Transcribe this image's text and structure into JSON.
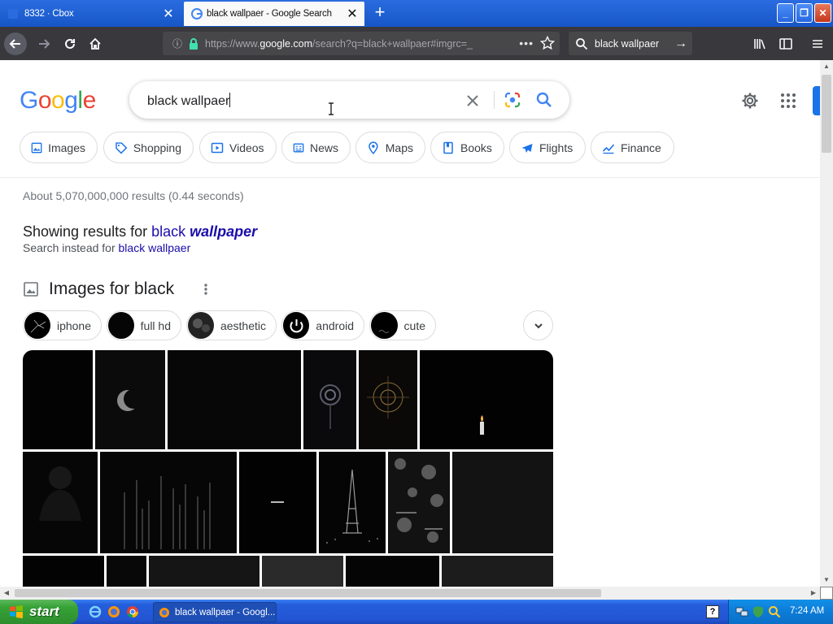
{
  "browser": {
    "tabs": [
      {
        "title": "8332 · Cbox",
        "active": false
      },
      {
        "title": "black wallpaer - Google Search",
        "active": true
      }
    ],
    "url": {
      "prefix": "https://www.",
      "domain": "google.com",
      "path": "/search?q=black+wallpaer#imgrc=_"
    },
    "search_bar_text": "black wallpaer"
  },
  "google": {
    "logo": [
      "G",
      "o",
      "o",
      "g",
      "l",
      "e"
    ],
    "logo_colors": [
      "#4285f4",
      "#ea4335",
      "#fbbc05",
      "#4285f4",
      "#34a853",
      "#ea4335"
    ],
    "query": "black wallpaer",
    "chips": [
      {
        "label": "Images",
        "icon": "image-icon"
      },
      {
        "label": "Shopping",
        "icon": "tag-icon"
      },
      {
        "label": "Videos",
        "icon": "play-icon"
      },
      {
        "label": "News",
        "icon": "newspaper-icon"
      },
      {
        "label": "Maps",
        "icon": "map-pin-icon"
      },
      {
        "label": "Books",
        "icon": "book-icon"
      },
      {
        "label": "Flights",
        "icon": "plane-icon"
      },
      {
        "label": "Finance",
        "icon": "chart-icon"
      }
    ],
    "stats": "About 5,070,000,000 results (0.44 seconds)",
    "spell": {
      "showing_prefix": "Showing results for ",
      "corrected_plain": "black ",
      "corrected_bold": "wallpaper",
      "instead_prefix": "Search instead for ",
      "instead_link": "black wallpaer"
    },
    "images_heading": "Images for black",
    "refine_chips": [
      "iphone",
      "full hd",
      "aesthetic",
      "android",
      "cute"
    ]
  },
  "taskbar": {
    "start_label": "start",
    "task_item": "black wallpaer - Googl...",
    "help_label": "?",
    "clock": "7:24 AM"
  },
  "colors": {
    "accent_blue": "#1a73e8",
    "link": "#1a0dab",
    "firefox_toolbar": "#38383d",
    "xp_taskbar": "#245edb"
  }
}
